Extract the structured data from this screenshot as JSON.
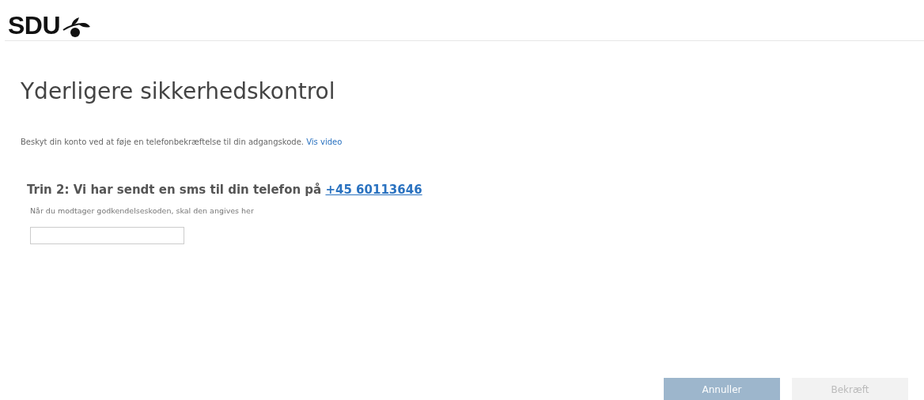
{
  "header": {
    "logo": "SDU"
  },
  "title": "Yderligere sikkerhedskontrol",
  "description": {
    "text": "Beskyt din konto ved at føje en telefonbekræftelse til din adgangskode.",
    "link": "Vis video"
  },
  "step": {
    "text": "Trin 2: Vi har sendt en sms til din telefon på",
    "phone": "+45 60113646"
  },
  "code_field": {
    "label": "Når du modtager godkendelseskoden, skal den angives her"
  },
  "buttons": [
    {
      "label": "Annuller",
      "disabled": false
    },
    {
      "label": "Bekræft",
      "disabled": true
    }
  ]
}
